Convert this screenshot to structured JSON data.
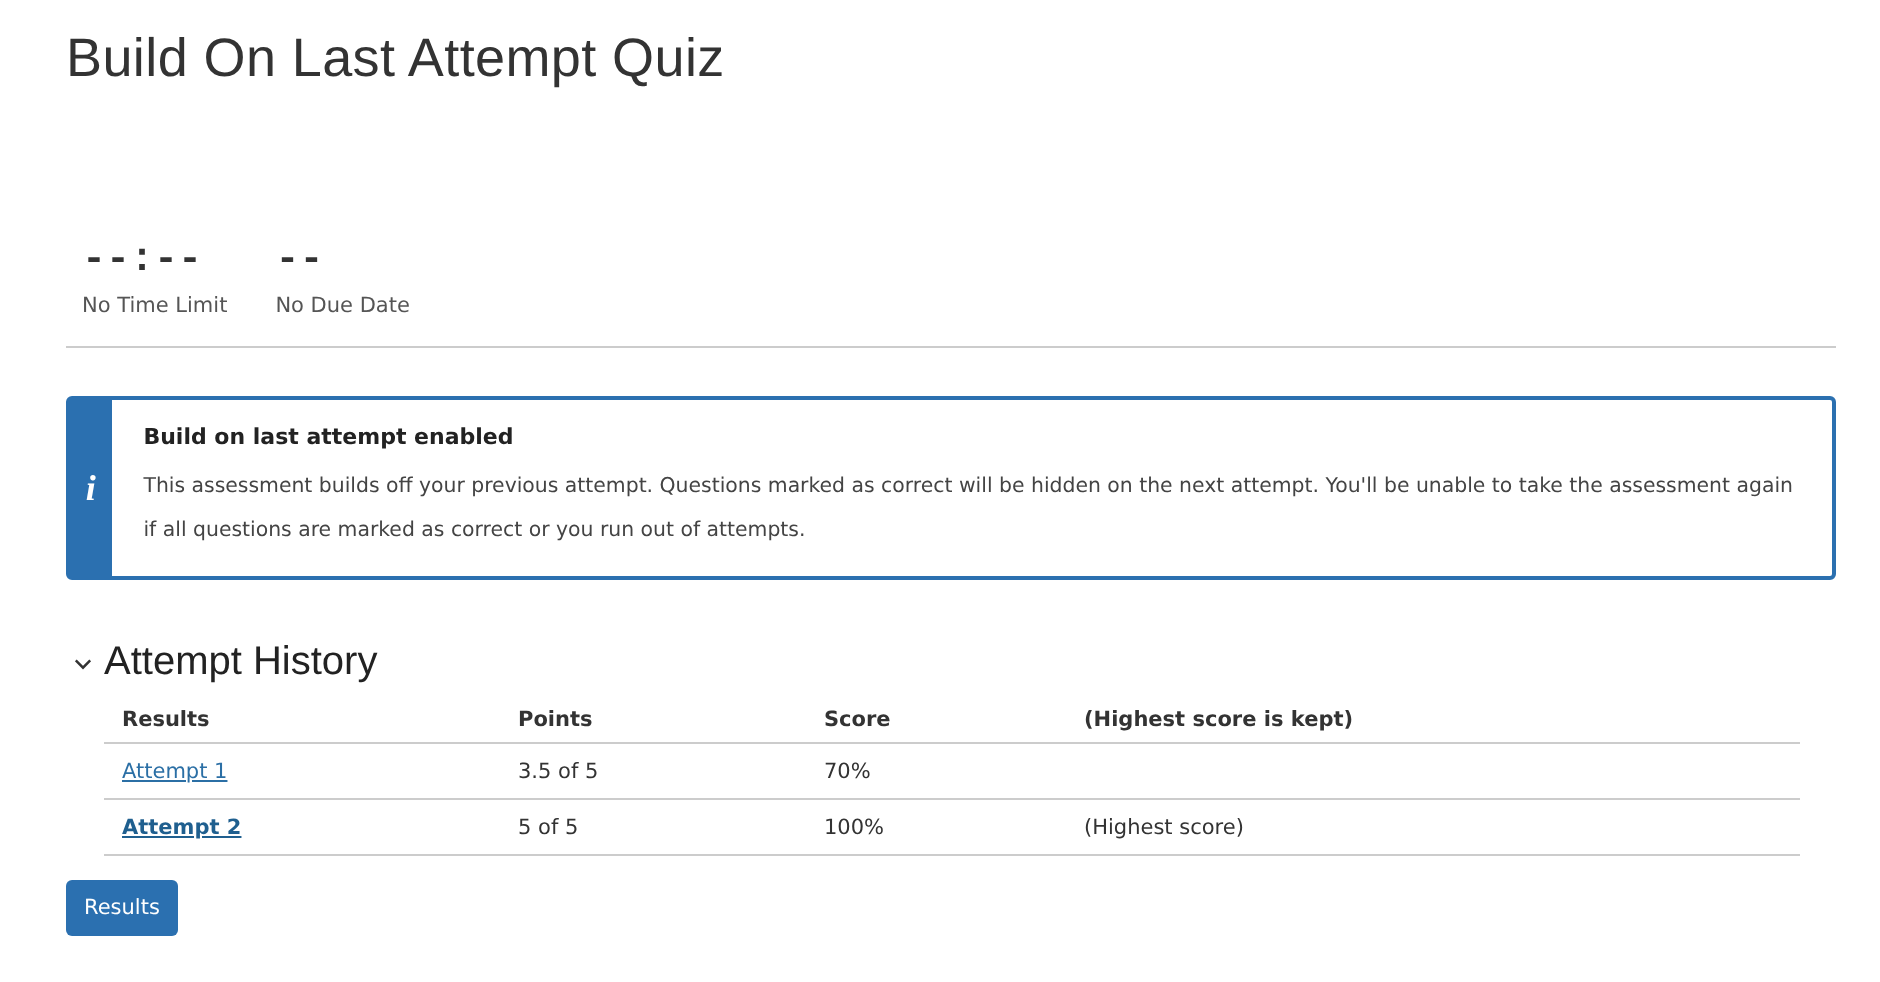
{
  "page_title": "Build On Last Attempt Quiz",
  "stats": [
    {
      "value": "--:--",
      "label": "No Time Limit"
    },
    {
      "value": "--",
      "label": "No Due Date"
    }
  ],
  "notice": {
    "icon": "i",
    "title": "Build on last attempt enabled",
    "text": "This assessment builds off your previous attempt. Questions marked as correct will be hidden on the next attempt. You'll be unable to take the assessment again if all questions are marked as correct or you run out of attempts."
  },
  "attempt_history": {
    "heading": "Attempt History",
    "expanded": true,
    "columns": [
      "Results",
      "Points",
      "Score",
      "(Highest score is kept)"
    ],
    "rows": [
      {
        "attempt": "Attempt 1",
        "points": "3.5 of 5",
        "score": "70%",
        "highest": false
      },
      {
        "attempt": "Attempt 2",
        "points": "5 of 5",
        "score": "100%",
        "note": "(Highest score)",
        "highest": true
      }
    ]
  },
  "button": "Results"
}
